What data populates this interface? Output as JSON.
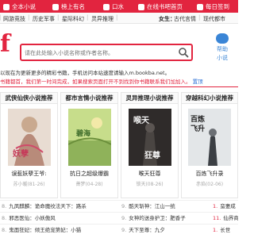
{
  "topbar": {
    "items": [
      {
        "label": "全本小说",
        "icon": "book-icon"
      },
      {
        "label": "榜上有名",
        "icon": "trophy-icon"
      },
      {
        "label": "口水",
        "icon": "chat-icon"
      },
      {
        "label": "在线书吧首页",
        "icon": "home-icon"
      },
      {
        "label": "每日签到",
        "icon": "calendar-icon"
      }
    ]
  },
  "nav": {
    "items": [
      "网游竞技",
      "历史军事",
      "星际科幻",
      "灵异推理"
    ],
    "label": "女生：",
    "items2": [
      "古代言情",
      "现代都市"
    ]
  },
  "search": {
    "placeholder": "请在此处输入小说名称或作者名称。"
  },
  "right_icon": {
    "label1": "帮助",
    "label2": "小说"
  },
  "notices": {
    "line1": "以现在为更新更多的精彩书籍，手机访问本站速度请输入m.bookba.net。",
    "line2": "书籍都首，我们第一时间完成，如果搜索页面打开不到找到你书籍联系我们加加入。",
    "line2_link": "置顶"
  },
  "categories": [
    {
      "header": "武侠仙侠小说推荐",
      "title": "误惹妖孽王爷:",
      "author": "苏小暖(81-26)",
      "cover_color": "#d7c6b8",
      "cover_text": "妖孽王爷"
    },
    {
      "header": "都市言情小说推荐",
      "title": "抗日之超级爆霸",
      "author": "萧梦(04-28)",
      "cover_color": "#b9d17a",
      "cover_text": "碧海茫茫"
    },
    {
      "header": "灵异推理小说推荐",
      "title": "喉天狂尊",
      "author": "锁天(08-26)",
      "cover_color": "#2f2b2a",
      "cover_text": "喉天狂尊"
    },
    {
      "header": "穿越科幻小说推荐",
      "title": "百炼飞升录",
      "author": "赤焰(02-06)",
      "cover_color": "#d8dcdf",
      "cover_text": "百炼飞升录"
    }
  ],
  "list": [
    {
      "num": "8.",
      "text": "九凤麒麟：诡命魔纹",
      "extra": "法天下：路杀"
    },
    {
      "num": "9.",
      "text": "酷天斩神：江山一统",
      "extra": ""
    },
    {
      "num": "1.",
      "text": "蛮妻成",
      "extra": ""
    },
    {
      "num": "8.",
      "text": "邪恶医仙：小妖傲风",
      "extra": ""
    },
    {
      "num": "9.",
      "text": "女神的送身护卫：肥香子",
      "extra": ""
    },
    {
      "num": "11.",
      "text": "仙界商会",
      "extra": ""
    },
    {
      "num": "8.",
      "text": "鬼面狂妃：倾王绝宠第妃",
      "extra": "：小猫"
    },
    {
      "num": "9.",
      "text": "天下至尊：九夕",
      "extra": ""
    },
    {
      "num": "1.",
      "text": "长世",
      "extra": ""
    }
  ]
}
